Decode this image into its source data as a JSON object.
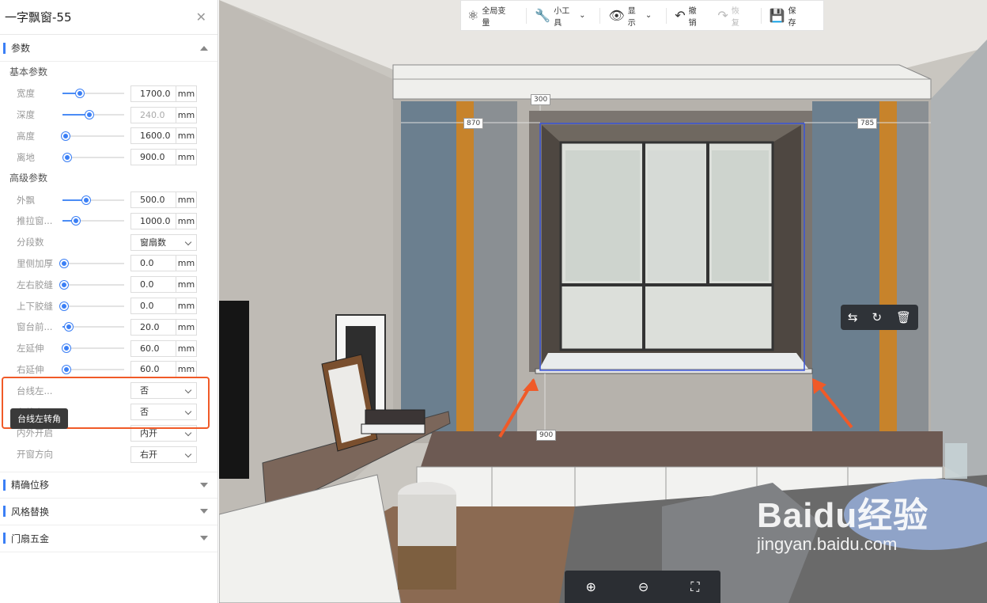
{
  "panel": {
    "title": "一字飘窗-55",
    "sections": {
      "params": "参数",
      "precise_move": "精确位移",
      "style_replace": "风格替换",
      "hardware": "门扇五金"
    },
    "basic_heading": "基本参数",
    "advanced_heading": "高级参数",
    "basic_rows": [
      {
        "label": "宽度",
        "value": "1700.0",
        "unit": "mm",
        "level": 0.28,
        "disabled": false
      },
      {
        "label": "深度",
        "value": "240.0",
        "unit": "mm",
        "level": 0.43,
        "disabled": true
      },
      {
        "label": "高度",
        "value": "1600.0",
        "unit": "mm",
        "level": 0.05,
        "disabled": false
      },
      {
        "label": "离地",
        "value": "900.0",
        "unit": "mm",
        "level": 0.08,
        "disabled": false
      }
    ],
    "advanced_rows": [
      {
        "label": "外飘",
        "value": "500.0",
        "unit": "mm",
        "level": 0.38
      },
      {
        "label": "推拉窗...",
        "value": "1000.0",
        "unit": "mm",
        "level": 0.22
      },
      {
        "label": "分段数",
        "select": "窗扇数"
      },
      {
        "label": "里侧加厚",
        "value": "0.0",
        "unit": "mm",
        "level": 0.02
      },
      {
        "label": "左右胶缝",
        "value": "0.0",
        "unit": "mm",
        "level": 0.02
      },
      {
        "label": "上下胶缝",
        "value": "0.0",
        "unit": "mm",
        "level": 0.02
      },
      {
        "label": "窗台前...",
        "value": "20.0",
        "unit": "mm",
        "level": 0.1
      },
      {
        "label": "左延伸",
        "value": "60.0",
        "unit": "mm",
        "level": 0.06
      },
      {
        "label": "右延伸",
        "value": "60.0",
        "unit": "mm",
        "level": 0.06
      }
    ],
    "select_rows": [
      {
        "label": "台线左...",
        "select": "否"
      },
      {
        "label": "台线右...",
        "select": "否"
      },
      {
        "label": "内外开启",
        "select": "内开"
      },
      {
        "label": "开窗方向",
        "select": "右开"
      }
    ],
    "tooltip": "台线左转角"
  },
  "toolbar": {
    "global_var": "全局变量",
    "tools": "小工具",
    "display": "显示",
    "undo": "撤销",
    "redo": "恢复",
    "save": "保存"
  },
  "dimensions": {
    "top": "300",
    "left": "870",
    "right": "785",
    "sill": "900"
  },
  "watermark": {
    "brand": "Baidu经验",
    "url": "jingyan.baidu.com"
  },
  "colors": {
    "accent": "#3b7ff5",
    "highlight": "#f05a28"
  }
}
